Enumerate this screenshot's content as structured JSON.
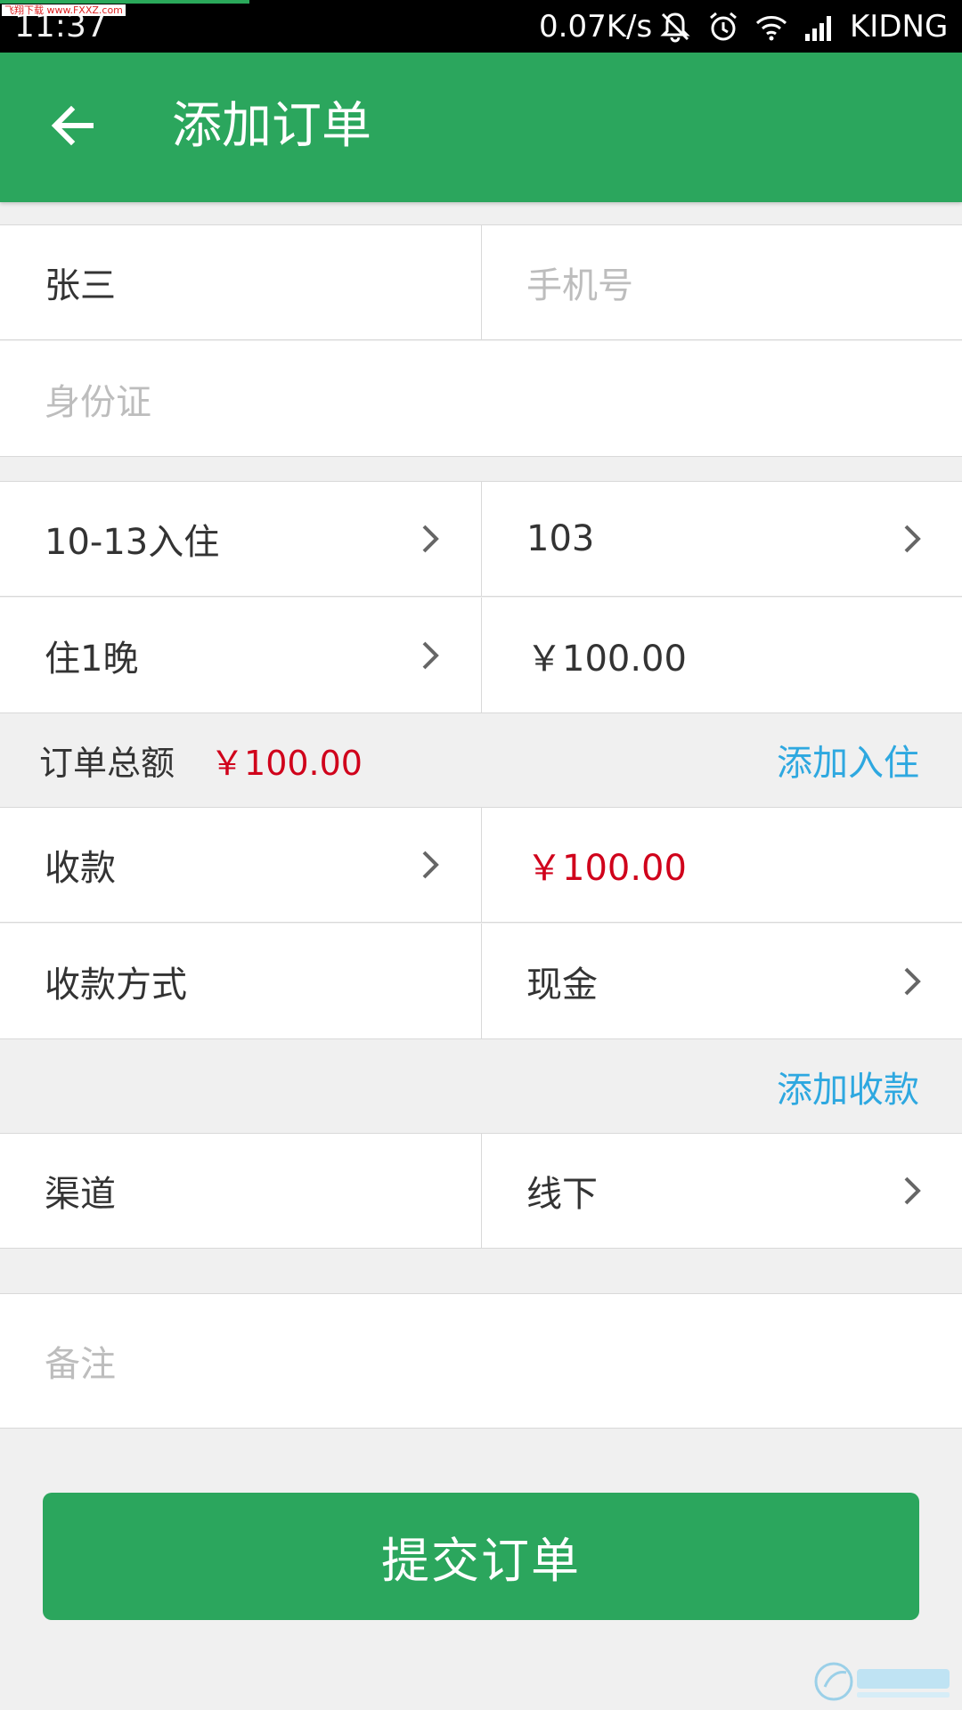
{
  "status_bar": {
    "watermark": "飞翔下载 www.FXXZ.com",
    "time": "11:37",
    "speed": "0.07K/s",
    "carrier": "KIDNG"
  },
  "app_bar": {
    "title": "添加订单"
  },
  "guest": {
    "name_value": "张三",
    "phone_placeholder": "手机号",
    "id_placeholder": "身份证"
  },
  "stay": {
    "checkin": "10-13入住",
    "room": "103",
    "nights": "住1晚",
    "price": "￥100.00"
  },
  "order_total": {
    "label": "订单总额",
    "amount": "￥100.00",
    "add_checkin_link": "添加入住"
  },
  "payment": {
    "label": "收款",
    "amount": "￥100.00",
    "method_label": "收款方式",
    "method_value": "现金",
    "add_payment_link": "添加收款"
  },
  "channel": {
    "label": "渠道",
    "value": "线下"
  },
  "remark": {
    "placeholder": "备注"
  },
  "submit_label": "提交订单",
  "colors": {
    "primary": "#2ba65d",
    "price_red": "#d0021b",
    "link_blue": "#2ea8e0"
  }
}
